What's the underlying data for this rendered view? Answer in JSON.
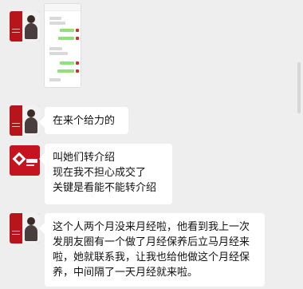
{
  "messages": [
    {
      "type": "image",
      "avatar_icon": "portrait-avatar-icon",
      "colors": {
        "avatar_red": "#b8141c",
        "bubble": "#ffffff",
        "accent_green": "#8fe27a"
      }
    },
    {
      "type": "text",
      "text": "在来个给力的",
      "avatar_icon": "portrait-avatar-icon"
    },
    {
      "type": "text",
      "text": "叫她们转介绍\n现在我不担心成交了\n关键是看能不能转介绍",
      "avatar_icon": "brand-logo-icon"
    },
    {
      "type": "text",
      "text": "这个人两个月没来月经啦，他看到我上一次发朋友圈有一个做了月经保养后立马月经来啦，她就联系我，让我也给他做这个月经保养，中间隔了一天月经就来啦。",
      "avatar_icon": "portrait-avatar-icon"
    }
  ]
}
